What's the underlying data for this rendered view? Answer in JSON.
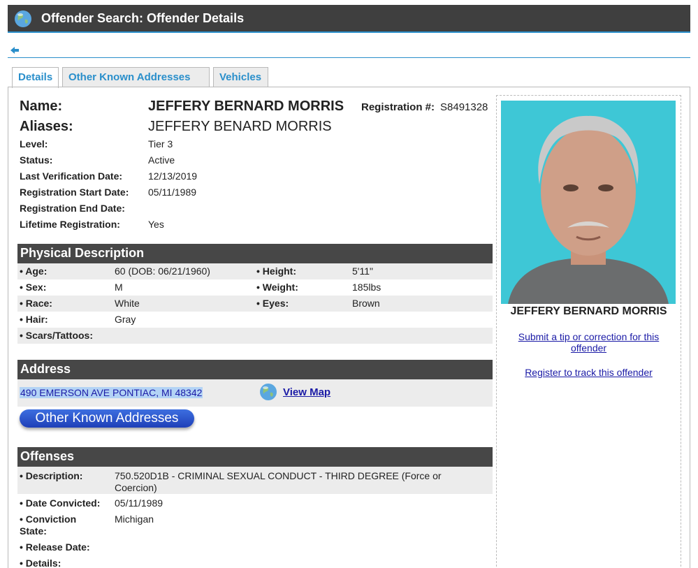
{
  "header": {
    "title": "Offender Search: Offender Details",
    "globe_icon": "globe-icon"
  },
  "nav": {
    "back_icon": "back-arrow-icon"
  },
  "tabs": [
    {
      "label": "Details",
      "active": true
    },
    {
      "label": "Other Known Addresses",
      "active": false
    },
    {
      "label": "Vehicles",
      "active": false
    }
  ],
  "offender": {
    "name_label": "Name:",
    "name": "JEFFERY BERNARD MORRIS",
    "registration_label": "Registration #:",
    "registration_number": "S8491328",
    "aliases_label": "Aliases:",
    "aliases": "JEFFERY BENARD MORRIS",
    "fields": [
      {
        "label": "Level:",
        "value": "Tier 3"
      },
      {
        "label": "Status:",
        "value": "Active"
      },
      {
        "label": "Last Verification Date:",
        "value": "12/13/2019"
      },
      {
        "label": "Registration Start Date:",
        "value": "05/11/1989"
      },
      {
        "label": "Registration End Date:",
        "value": ""
      },
      {
        "label": "Lifetime Registration:",
        "value": "Yes"
      }
    ]
  },
  "physical": {
    "heading": "Physical Description",
    "age_label": "• Age:",
    "age": "60  (DOB: 06/21/1960)",
    "height_label": "• Height:",
    "height": "5'11\"",
    "sex_label": "• Sex:",
    "sex": "M",
    "weight_label": "• Weight:",
    "weight": "185lbs",
    "race_label": "• Race:",
    "race": "White",
    "eyes_label": "• Eyes:",
    "eyes": "Brown",
    "hair_label": "• Hair:",
    "hair": "Gray",
    "scars_label": "• Scars/Tattoos:",
    "scars": ""
  },
  "address": {
    "heading": "Address",
    "text": "490 EMERSON AVE PONTIAC, MI 48342",
    "view_map": "View Map",
    "map_icon": "globe-map-icon",
    "other_addresses_button": "Other Known Addresses"
  },
  "offenses": {
    "heading": "Offenses",
    "description_label": "• Description:",
    "description_line1": "750.520D1B - CRIMINAL SEXUAL CONDUCT - THIRD DEGREE (Force or",
    "description_line2": "Coercion)",
    "date_convicted_label": "• Date Convicted:",
    "date_convicted": "05/11/1989",
    "conviction_state_label_1": "• Conviction",
    "conviction_state_label_2": "State:",
    "conviction_state": "Michigan",
    "release_date_label": "• Release Date:",
    "details_label": "• Details:"
  },
  "sidebar": {
    "photo_name": "JEFFERY BERNARD MORRIS",
    "tip_link_line1": "Submit a tip or correction for this",
    "tip_link_line2": "offender",
    "register_link": "Register to track this offender"
  }
}
